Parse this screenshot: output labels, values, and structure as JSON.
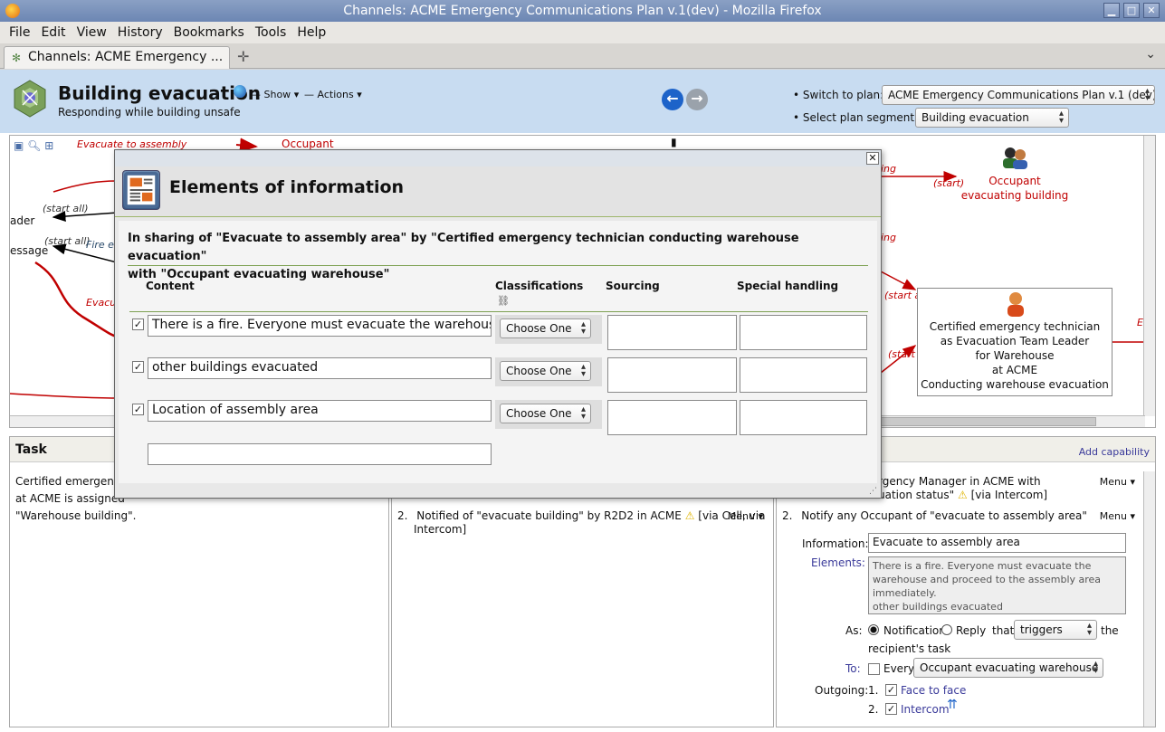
{
  "window": {
    "title": "Channels: ACME Emergency Communications Plan v.1(dev) - Mozilla Firefox",
    "buttons": [
      "▁",
      "□",
      "✕"
    ]
  },
  "menubar": [
    {
      "label": "File"
    },
    {
      "label": "Edit"
    },
    {
      "label": "View"
    },
    {
      "label": "History"
    },
    {
      "label": "Bookmarks"
    },
    {
      "label": "Tools"
    },
    {
      "label": "Help"
    }
  ],
  "tabs": [
    {
      "label": "Channels: ACME Emergency ..."
    }
  ],
  "header": {
    "segment_title": "Building evacuation",
    "segment_subtitle": "Responding while building unsafe",
    "show_label": "— Show",
    "actions_label": "— Actions",
    "switch_plan_label": "Switch to plan:",
    "switch_plan_value": "ACME Emergency Communications Plan v.1 (dev)",
    "select_segment_label": "Select plan segment:",
    "select_segment_value": "Building evacuation"
  },
  "flow": {
    "labels": {
      "evacuate_to_assembly": "Evacuate to assembly",
      "occupant_top": "Occupant",
      "start_all_1": "(start all)",
      "leader": "ader",
      "message": "essage",
      "start_all_2": "(start all)",
      "fire_ex": "Fire ex",
      "evacu": "Evacu",
      "start_right": "(start)",
      "ing_1": "ing",
      "ing_2": "ing",
      "start_all_3": "(start all)",
      "start_all_4": "(start all)",
      "e_right": "E"
    },
    "occupant_node": [
      "Occupant",
      "evacuating building"
    ],
    "technician_node": [
      "Certified emergency technician",
      "as Evacuation Team Leader",
      "for Warehouse",
      "at ACME",
      "Conducting warehouse evacuation"
    ]
  },
  "panels": {
    "task": {
      "title": "Task",
      "text": [
        "Certified emergency",
        "at ACME is assigned",
        "\"Warehouse building\"."
      ]
    },
    "middle": {
      "item_number": "2.",
      "item_text": "Notified of \"evacuate building\" by R2D2 in ACME",
      "item_via": "[via Cell, via",
      "item_via2": "Intercom]",
      "menu_label": "Menu"
    },
    "right": {
      "add_capability": "Add capability",
      "line1": "rgency Manager in ACME with",
      "line2": "uation status\"",
      "line2_via": "[via Intercom]",
      "menu_label": "Menu",
      "item_number": "2.",
      "item_text": "Notify any Occupant of \"evacuate to assembly area\"",
      "information_label": "Information:",
      "information_value": "Evacuate to assembly area",
      "elements_label": "Elements:",
      "elements_text": [
        "There is a fire. Everyone must evacuate the",
        "warehouse and proceed to the assembly area",
        "immediately.",
        "other buildings evacuated"
      ],
      "as_label": "As:",
      "notification_label": "Notification",
      "reply_label": "Reply",
      "that_label": "that",
      "triggers_value": "triggers",
      "the_label": "the",
      "recipient_task": "recipient's task",
      "to_label": "To:",
      "every_label": "Every",
      "recipient_value": "Occupant evacuating warehouse",
      "outgoing_label": "Outgoing:",
      "outgoing": [
        {
          "num": "1.",
          "label": "Face to face"
        },
        {
          "num": "2.",
          "label": "Intercom"
        }
      ]
    }
  },
  "modal": {
    "title": "Elements of information",
    "sharing_line1": "In sharing of \"Evacuate to assembly area\" by \"Certified emergency technician conducting warehouse evacuation\"",
    "sharing_line2": "with \"Occupant evacuating warehouse\"",
    "columns": {
      "content": "Content",
      "classifications": "Classifications",
      "sourcing": "Sourcing",
      "special_handling": "Special handling"
    },
    "rows": [
      {
        "checked": true,
        "content": "There is a fire. Everyone must evacuate the warehouse",
        "classification": "Choose One"
      },
      {
        "checked": true,
        "content": "other buildings evacuated",
        "classification": "Choose One"
      },
      {
        "checked": true,
        "content": "Location of assembly area",
        "classification": "Choose One"
      }
    ],
    "new_row_placeholder": ""
  },
  "colors": {
    "header_bg": "#c8dcf1",
    "flow_red": "#c00000",
    "accent_green": "#7ea152",
    "link_blue": "#3a3a9a"
  }
}
